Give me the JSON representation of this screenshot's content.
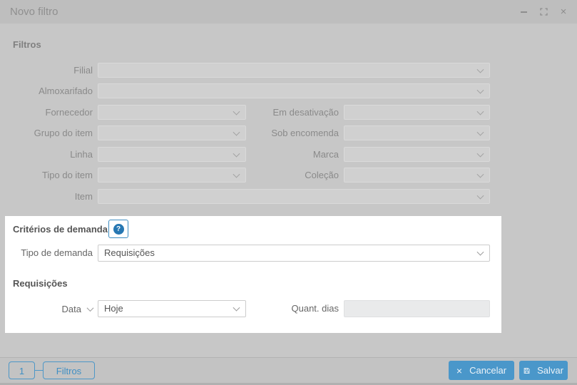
{
  "titlebar": {
    "title": "Novo filtro"
  },
  "filters": {
    "section_title": "Filtros",
    "rows_full_top": [
      {
        "label": "Filial"
      },
      {
        "label": "Almoxarifado"
      }
    ],
    "rows_pairs": [
      {
        "left": "Fornecedor",
        "right": "Em desativação"
      },
      {
        "left": "Grupo do item",
        "right": "Sob encomenda"
      },
      {
        "left": "Linha",
        "right": "Marca"
      },
      {
        "left": "Tipo do item",
        "right": "Coleção"
      }
    ],
    "row_item": {
      "label": "Item"
    }
  },
  "demand_criteria": {
    "section_title": "Critérios de demanda",
    "help_icon": "?",
    "tipo_de_demanda_label": "Tipo de demanda",
    "tipo_de_demanda_value": "Requisições"
  },
  "requisicoes": {
    "section_title": "Requisições",
    "data_label": "Data",
    "data_value": "Hoje",
    "quant_dias_label": "Quant. dias",
    "quant_dias_value": ""
  },
  "footer": {
    "page_number": "1",
    "filters_button_label": "Filtros",
    "cancel_label": "Cancelar",
    "cancel_icon": "×",
    "save_label": "Salvar"
  },
  "window_controls": {
    "close_icon": "×"
  },
  "colors": {
    "accent_blue": "#3d8cc0",
    "button_blue": "#4a97ca",
    "spotlight_bg": "#ffffff",
    "dim_background": "#c7c7c7"
  }
}
